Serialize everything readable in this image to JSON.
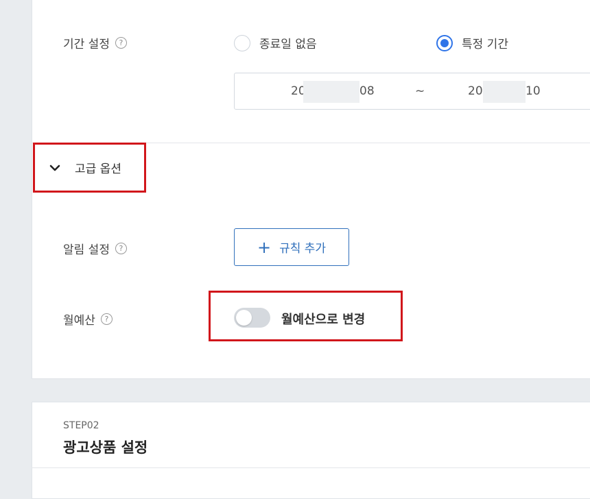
{
  "period": {
    "label": "기간 설정",
    "help_icon": "question-circle-icon",
    "option_no_end": "종료일 없음",
    "option_specific": "특정 기간",
    "selected": "특정 기간",
    "date_start": "20",
    "date_start_tail": "08",
    "date_sep": "~",
    "date_end": "20",
    "date_end_tail": "10"
  },
  "advanced": {
    "toggle_label": "고급 옵션",
    "icon": "chevron-down-icon"
  },
  "alert": {
    "label": "알림 설정",
    "button_label": "규칙 추가",
    "button_icon": "plus-icon"
  },
  "monthly": {
    "label": "월예산",
    "toggle_on": false,
    "toggle_label": "월예산으로 변경"
  },
  "step2": {
    "step": "STEP02",
    "title": "광고상품 설정"
  },
  "colors": {
    "accent": "#2f74e8",
    "button_text": "#2f6fbb",
    "highlight": "#d1161b"
  }
}
